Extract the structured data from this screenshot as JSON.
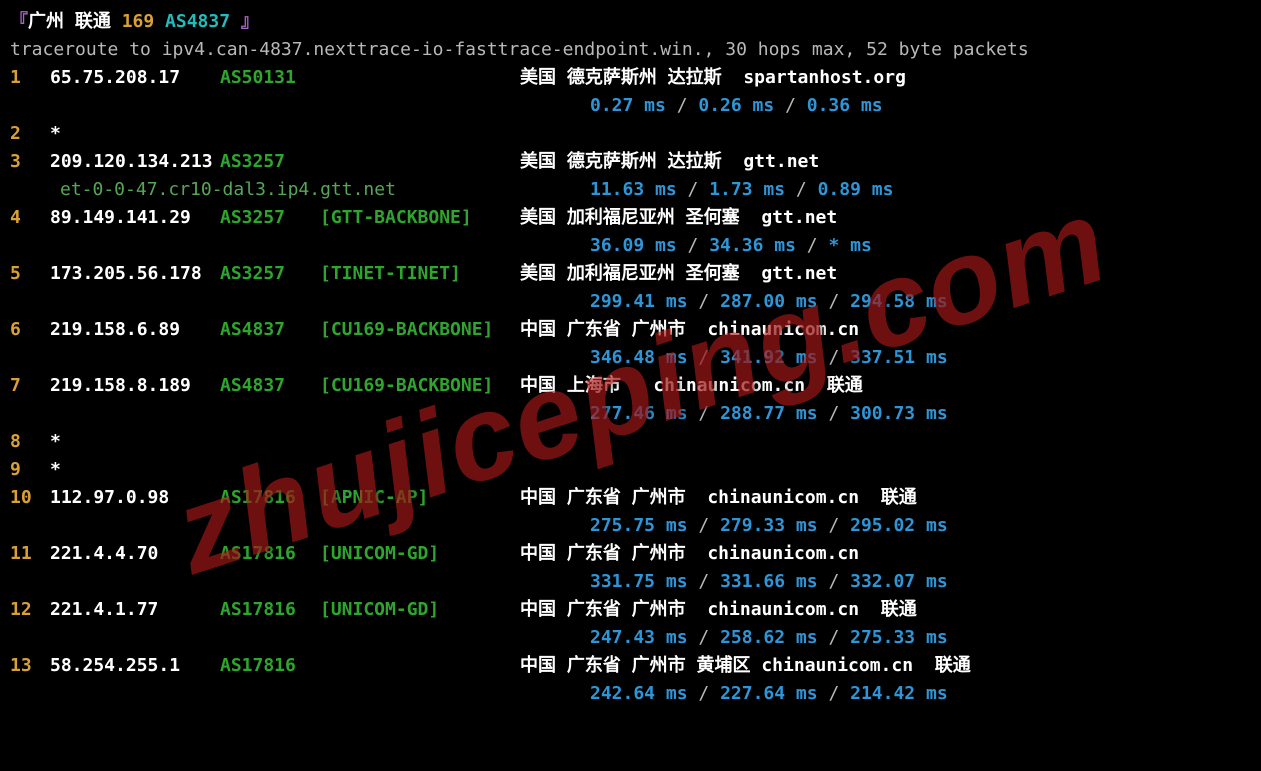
{
  "header": {
    "bracket_l": "『",
    "city": "广州",
    "isp": "联通",
    "route": "169",
    "asn": "AS4837",
    "bracket_r": "』"
  },
  "trace_intro": "traceroute to ipv4.can-4837.nexttrace-io-fasttrace-endpoint.win., 30 hops max, 52 byte packets",
  "hops": [
    {
      "n": "1",
      "ip": "65.75.208.17",
      "asn": "AS50131",
      "net": "",
      "loc": "美国 德克萨斯州 达拉斯  spartanhost.org",
      "lat": [
        "0.27 ms",
        "0.26 ms",
        "0.36 ms"
      ]
    },
    {
      "n": "2",
      "ip": "*",
      "asn": "",
      "net": "",
      "loc": "",
      "lat": []
    },
    {
      "n": "3",
      "ip": "209.120.134.213",
      "asn": "AS3257",
      "net": "",
      "loc": "美国 德克萨斯州 达拉斯  gtt.net",
      "rdns": "et-0-0-47.cr10-dal3.ip4.gtt.net",
      "lat": [
        "11.63 ms",
        "1.73 ms",
        "0.89 ms"
      ]
    },
    {
      "n": "4",
      "ip": "89.149.141.29",
      "asn": "AS3257",
      "net": "[GTT-BACKBONE]",
      "loc": "美国 加利福尼亚州 圣何塞  gtt.net",
      "lat": [
        "36.09 ms",
        "34.36 ms",
        "* ms"
      ]
    },
    {
      "n": "5",
      "ip": "173.205.56.178",
      "asn": "AS3257",
      "net": "[TINET-TINET]",
      "loc": "美国 加利福尼亚州 圣何塞  gtt.net",
      "lat": [
        "299.41 ms",
        "287.00 ms",
        "294.58 ms"
      ]
    },
    {
      "n": "6",
      "ip": "219.158.6.89",
      "asn": "AS4837",
      "net": "[CU169-BACKBONE]",
      "loc": "中国 广东省 广州市  chinaunicom.cn",
      "lat": [
        "346.48 ms",
        "341.92 ms",
        "337.51 ms"
      ]
    },
    {
      "n": "7",
      "ip": "219.158.8.189",
      "asn": "AS4837",
      "net": "[CU169-BACKBONE]",
      "loc": "中国 上海市   chinaunicom.cn  联通",
      "lat": [
        "277.46 ms",
        "288.77 ms",
        "300.73 ms"
      ]
    },
    {
      "n": "8",
      "ip": "*",
      "asn": "",
      "net": "",
      "loc": "",
      "lat": []
    },
    {
      "n": "9",
      "ip": "*",
      "asn": "",
      "net": "",
      "loc": "",
      "lat": []
    },
    {
      "n": "10",
      "ip": "112.97.0.98",
      "asn": "AS17816",
      "net": "[APNIC-AP]",
      "loc": "中国 广东省 广州市  chinaunicom.cn  联通",
      "lat": [
        "275.75 ms",
        "279.33 ms",
        "295.02 ms"
      ]
    },
    {
      "n": "11",
      "ip": "221.4.4.70",
      "asn": "AS17816",
      "net": "[UNICOM-GD]",
      "loc": "中国 广东省 广州市  chinaunicom.cn",
      "lat": [
        "331.75 ms",
        "331.66 ms",
        "332.07 ms"
      ]
    },
    {
      "n": "12",
      "ip": "221.4.1.77",
      "asn": "AS17816",
      "net": "[UNICOM-GD]",
      "loc": "中国 广东省 广州市  chinaunicom.cn  联通",
      "lat": [
        "247.43 ms",
        "258.62 ms",
        "275.33 ms"
      ]
    },
    {
      "n": "13",
      "ip": "58.254.255.1",
      "asn": "AS17816",
      "net": "",
      "loc": "中国 广东省 广州市 黄埔区 chinaunicom.cn  联通",
      "lat": [
        "242.64 ms",
        "227.64 ms",
        "214.42 ms"
      ]
    }
  ],
  "sep": " / ",
  "watermark": "zhujiceping.com"
}
